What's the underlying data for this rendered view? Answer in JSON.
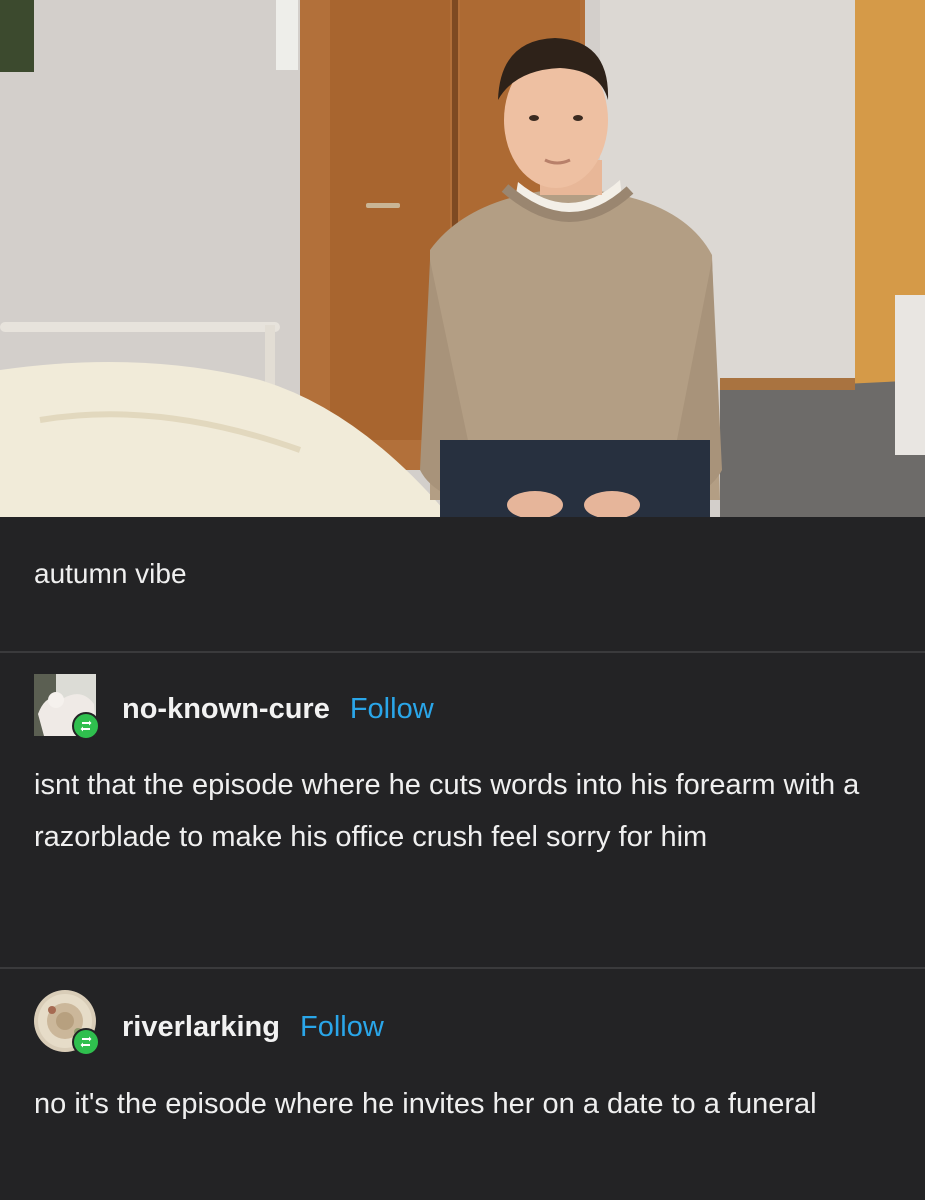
{
  "post": {
    "caption": "autumn vibe"
  },
  "replies": [
    {
      "username": "no-known-cure",
      "follow_label": "Follow",
      "text": "isnt that the episode where he cuts words into his forearm with a razorblade to make his office crush feel sorry for him"
    },
    {
      "username": "riverlarking",
      "follow_label": "Follow",
      "text": "no it's the episode where he invites her on a date to a funeral"
    }
  ],
  "colors": {
    "background": "#232325",
    "follow_link": "#2aa6e9",
    "reblog_badge": "#2fbf4e"
  },
  "icons": [
    "reblog-icon"
  ]
}
